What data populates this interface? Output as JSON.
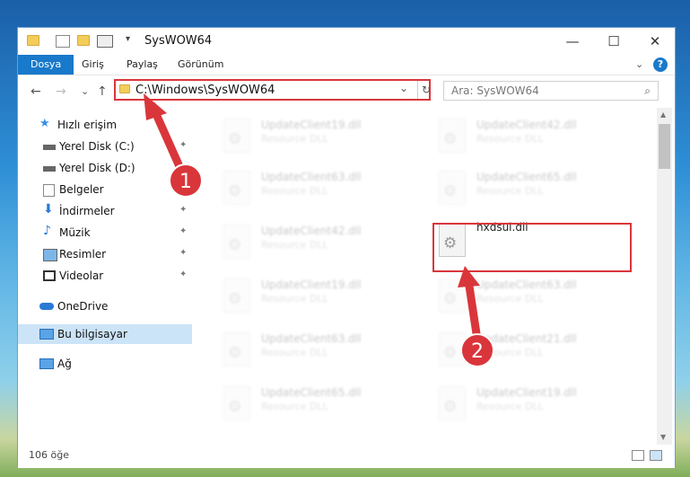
{
  "window": {
    "title": "SysWOW64",
    "minimize": "—",
    "maximize": "☐",
    "close": "✕"
  },
  "ribbon": {
    "tabs": [
      "Dosya",
      "Giriş",
      "Paylaş",
      "Görünüm"
    ],
    "help": "?",
    "expand": "⌄"
  },
  "nav": {
    "back": "←",
    "forward": "→",
    "recent": "⌄",
    "up": "↑"
  },
  "address": {
    "path": "C:\\Windows\\SysWOW64",
    "refresh": "↻",
    "dropdown": "⌄"
  },
  "search": {
    "placeholder": "Ara: SysWOW64",
    "icon": "⌕"
  },
  "sidebar": {
    "items": [
      {
        "label": "Hızlı erişim",
        "icon": "star-icon"
      },
      {
        "label": "Yerel Disk (C:)",
        "icon": "drive-icon",
        "pinned": true
      },
      {
        "label": "Yerel Disk (D:)",
        "icon": "drive-icon"
      },
      {
        "label": "Belgeler",
        "icon": "documents-icon"
      },
      {
        "label": "İndirmeler",
        "icon": "download-icon",
        "pinned": true
      },
      {
        "label": "Müzik",
        "icon": "music-icon",
        "pinned": true
      },
      {
        "label": "Resimler",
        "icon": "pictures-icon",
        "pinned": true
      },
      {
        "label": "Videolar",
        "icon": "video-icon",
        "pinned": true
      },
      {
        "label": "OneDrive",
        "icon": "cloud-icon"
      },
      {
        "label": "Bu bilgisayar",
        "icon": "computer-icon",
        "selected": true
      },
      {
        "label": "Ağ",
        "icon": "network-icon"
      }
    ],
    "pin_glyph": "📌"
  },
  "files": [
    {
      "name": "UpdateClient19.dll",
      "type": "Resource DLL"
    },
    {
      "name": "UpdateClient42.dll",
      "type": "Resource DLL"
    },
    {
      "name": "UpdateClient63.dll",
      "type": "Resource DLL"
    },
    {
      "name": "UpdateClient65.dll",
      "type": "Resource DLL"
    },
    {
      "name": "UpdateClient42.dll",
      "type": "Resource DLL"
    },
    {
      "name": "hxdsui.dll",
      "type": ""
    },
    {
      "name": "UpdateClient19.dll",
      "type": "Resource DLL"
    },
    {
      "name": "UpdateClient63.dll",
      "type": "Resource DLL"
    },
    {
      "name": "UpdateClient63.dll",
      "type": "Resource DLL"
    },
    {
      "name": "UpdateClient21.dll",
      "type": "Resource DLL"
    },
    {
      "name": "UpdateClient65.dll",
      "type": "Resource DLL"
    },
    {
      "name": "UpdateClient19.dll",
      "type": "Resource DLL"
    }
  ],
  "status": {
    "count": "106 öğe"
  },
  "annotations": {
    "badge1": "1",
    "badge2": "2",
    "color": "#d9363b"
  }
}
